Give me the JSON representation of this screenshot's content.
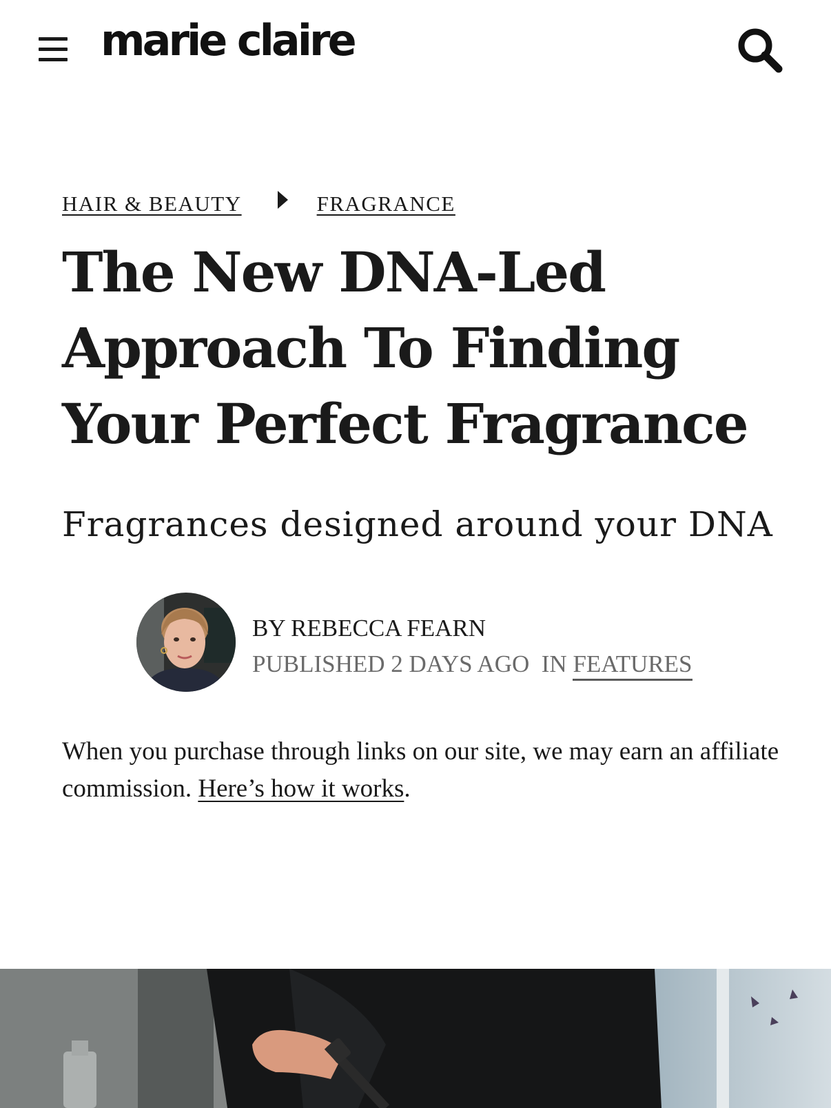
{
  "header": {
    "logo": "marie claire",
    "menu_icon": "hamburger-menu-icon",
    "search_icon": "search-icon"
  },
  "breadcrumb": {
    "items": [
      {
        "label": "HAIR & BEAUTY"
      },
      {
        "label": "FRAGRANCE"
      }
    ],
    "separator_icon": "caret-right-icon"
  },
  "article": {
    "title": "The New DNA-Led Approach To Finding Your Perfect Fragrance",
    "subtitle": "Fragrances designed around your DNA",
    "byline": {
      "author": "BY REBECCA FEARN",
      "published": "PUBLISHED 2 DAYS AGO",
      "in_label": "IN",
      "category": "FEATURES"
    },
    "disclaimer": {
      "text": "When you purchase through links on our site, we may earn an affiliate commission.",
      "link": "Here’s how it works",
      "end": "."
    }
  },
  "colors": {
    "text": "#1a1a1a",
    "muted": "#6a6a6a",
    "background": "#ffffff"
  }
}
